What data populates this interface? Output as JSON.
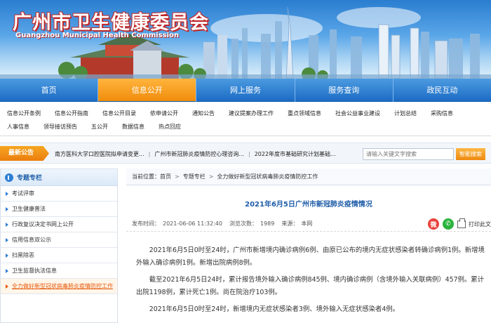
{
  "site": {
    "title": "广州市卫生健康委员会",
    "subtitle": "Guangzhou Municipal Health Commission"
  },
  "nav": {
    "items": [
      {
        "label": "首页",
        "active": false
      },
      {
        "label": "信息公开",
        "active": true
      },
      {
        "label": "网上服务",
        "active": false
      },
      {
        "label": "服务查询",
        "active": false
      },
      {
        "label": "政民互动",
        "active": false
      }
    ]
  },
  "sublinks": {
    "row1": [
      "信息公开条例",
      "信息公开指南",
      "信息公开目录",
      "依申请公开",
      "通知公告",
      "建议提案办理工作",
      "重点领域信息",
      "社会公益事业建设",
      "计划总结",
      "采购信息"
    ],
    "row2": [
      "人事信息",
      "领导接访预告",
      "五公开",
      "数据信息",
      "热点回应"
    ]
  },
  "notice": {
    "label": "最新公告",
    "items": [
      "南方医科大学口腔医院拟申请变更...",
      "广州市新冠肺炎疫情防控心理咨询...",
      "2022年度市基础研究计划基础..."
    ],
    "separator": "|",
    "search_placeholder": "请输入关键文字搜索",
    "search_button": "智能搜索"
  },
  "sidebar": {
    "title": "专题专栏",
    "items": [
      {
        "label": "考试评审",
        "active": false
      },
      {
        "label": "卫生健康普法",
        "active": false
      },
      {
        "label": "行政复议决定书网上公开",
        "active": false
      },
      {
        "label": "信用信息双公示",
        "active": false
      },
      {
        "label": "扫黑除恶",
        "active": false
      },
      {
        "label": "卫生监督执法信息",
        "active": false
      },
      {
        "label": "全力做好新型冠状病毒肺炎疫情防控工作",
        "active": true
      }
    ]
  },
  "breadcrumb": {
    "prefix": "当前位置：",
    "items": [
      "首页",
      "专题专栏",
      "全力做好新型冠状病毒肺炎疫情防控工作"
    ],
    "separator": ">"
  },
  "article": {
    "title": "2021年6月5日广州市新冠肺炎疫情情况",
    "meta": {
      "date_label": "发布时间：",
      "date": "2021-06-06 11:32:40",
      "views_label": "浏览次数：",
      "views": "1989",
      "source_label": "来源：",
      "source": "本网"
    },
    "print_label": "打印此文",
    "paragraphs": [
      "2021年6月5日0时至24时，广州市新增境内确诊病例6例、由原已公布的境内无症状感染者转确诊病例1例。新增境外输入确诊病例1例。新增出院病例8例。",
      "截至2021年6月5日24时，累计报告境外输入确诊病例845例、境内确诊病例（含境外输入关联病例）457例。累计出院1198例，累计死亡1例。尚在院治疗103例。",
      "2021年6月5日0时至24时，新增境内无症状感染者3例、境外输入无症状感染者4例。"
    ]
  },
  "colors": {
    "nav_blue": "#1c6cc5",
    "nav_active_orange": "#f08c0c",
    "title_blue": "#1d5ca8",
    "sidebar_active": "#e4580b",
    "weibo_red": "#e8403a",
    "wechat_green": "#2bb33d"
  },
  "icons": {
    "sidebar_header": "pin-icon",
    "weibo": "weibo-icon",
    "wechat": "wechat-icon",
    "print": "print-icon"
  }
}
